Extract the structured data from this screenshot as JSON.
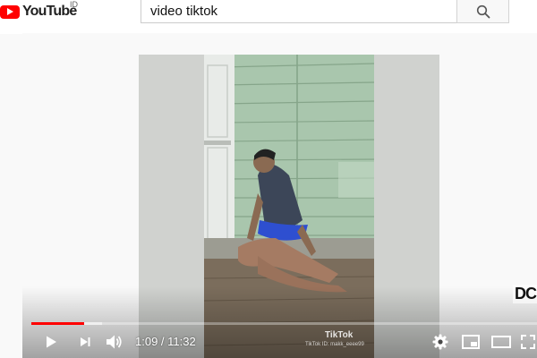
{
  "header": {
    "logo_text": "YouTube",
    "logo_country": "ID",
    "search": {
      "value": "video tiktok"
    }
  },
  "player": {
    "time": {
      "current": "1:09",
      "total": "11:32",
      "display": "1:09 / 11:32"
    },
    "progress": {
      "played_fraction": 0.104,
      "buffered_fraction": 0.14
    },
    "overlay": {
      "tiktok_label": "TikTok",
      "tiktok_id": "TikTok ID: makk_eeee99",
      "channel_watermark": "DC"
    }
  },
  "icons": {
    "search": "search-icon",
    "play": "play-icon",
    "next": "next-icon",
    "volume": "volume-icon",
    "settings": "gear-icon",
    "miniplayer": "miniplayer-icon",
    "theater": "theater-icon",
    "fullscreen": "fullscreen-icon"
  },
  "colors": {
    "brand_red": "#ff0000",
    "progress_played": "#ff0000",
    "wall_green": "#a9c6ad"
  }
}
